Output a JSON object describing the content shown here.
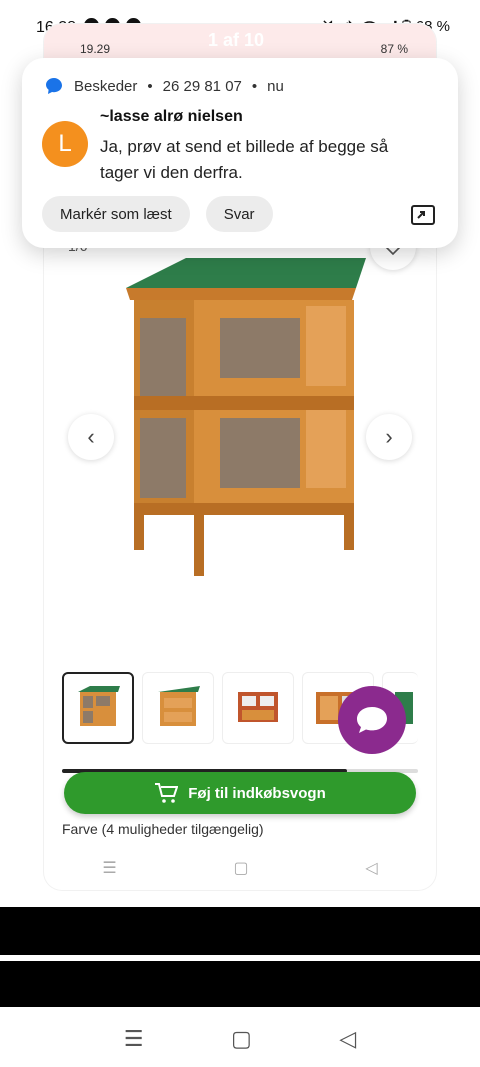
{
  "status": {
    "time": "16.28",
    "battery": "68 %"
  },
  "inner_status": {
    "time": "19.29",
    "battery": "87 %",
    "pager": "1 af 10"
  },
  "notification": {
    "app": "Beskeder",
    "number": "26 29 81 07",
    "when": "nu",
    "avatar_letter": "L",
    "sender": "~lasse alrø nielsen",
    "message": "Ja, prøv at send et billede af begge så tager vi den derfra.",
    "actions": [
      "Markér som læst",
      "Svar"
    ]
  },
  "product": {
    "image_counter": "1/6",
    "add_to_cart": "Føj til indkøbsvogn",
    "colour_options": "Farve (4 muligheder tilgængelig)",
    "thumbnail_count": 5,
    "scroll_progress": 0.8
  },
  "colors": {
    "cart_green": "#2f9a2c",
    "chat_purple": "#8b2a8e",
    "avatar_orange": "#f4901e",
    "app_icon_blue": "#1a73e8"
  }
}
